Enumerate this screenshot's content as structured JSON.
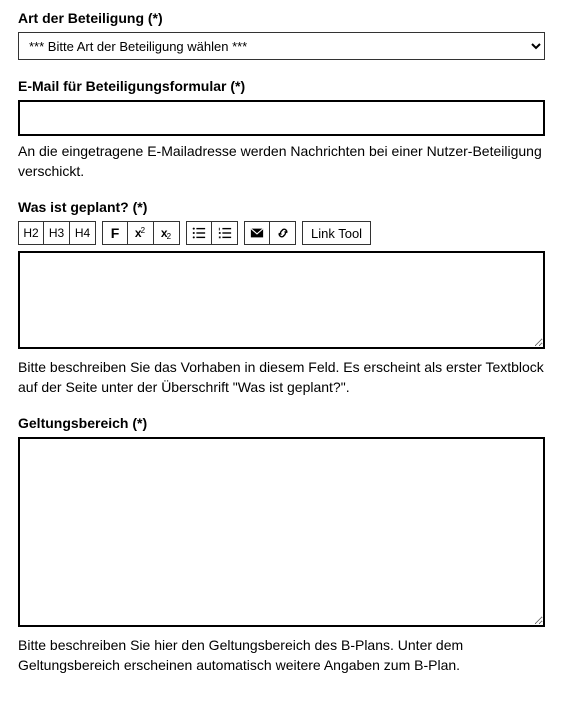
{
  "fields": {
    "participation_type": {
      "label": "Art der Beteiligung (*)",
      "selected": "*** Bitte Art der Beteiligung wählen ***"
    },
    "email": {
      "label": "E-Mail für Beteiligungsformular (*)",
      "value": "",
      "help": "An die eingetragene E-Mailadresse werden Nachrichten bei einer Nutzer-Beteiligung verschickt."
    },
    "planned": {
      "label": "Was ist geplant? (*)",
      "value": "",
      "help": "Bitte beschreiben Sie das Vorhaben in diesem Feld. Es erscheint als erster Textblock auf der Seite unter der Überschrift \"Was ist geplant?\"."
    },
    "scope": {
      "label": "Geltungsbereich (*)",
      "value": "",
      "help": "Bitte beschreiben Sie hier den Geltungsbereich des B-Plans. Unter dem Geltungsbereich erscheinen automatisch weitere Angaben zum B-Plan."
    }
  },
  "toolbar": {
    "h2": "H2",
    "h3": "H3",
    "h4": "H4",
    "bold": "F",
    "sup_x": "x",
    "sup_2": "2",
    "sub_x": "x",
    "sub_2": "2",
    "linktool": "Link Tool"
  }
}
